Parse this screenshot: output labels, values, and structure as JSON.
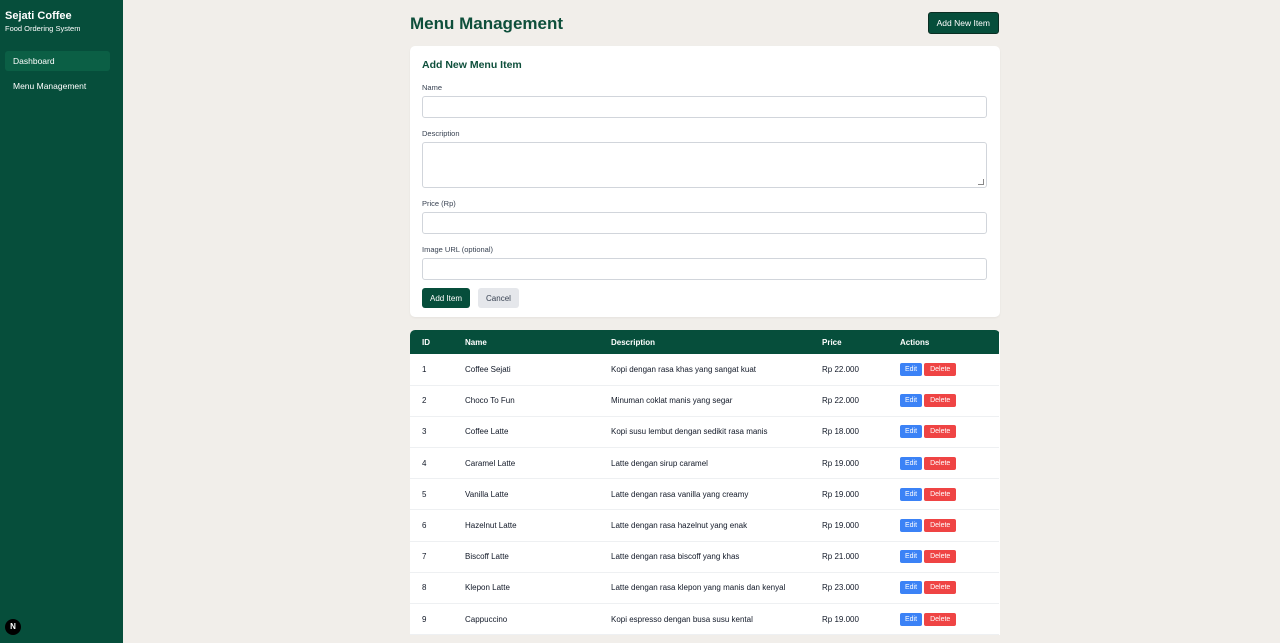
{
  "sidebar": {
    "brand_title": "Sejati Coffee",
    "brand_subtitle": "Food Ordering System",
    "items": [
      {
        "label": "Dashboard",
        "active": true
      },
      {
        "label": "Menu Management",
        "active": false
      }
    ],
    "badge": "N"
  },
  "header": {
    "title": "Menu Management",
    "add_new_label": "Add New Item"
  },
  "form": {
    "title": "Add New Menu Item",
    "name_label": "Name",
    "name_value": "",
    "description_label": "Description",
    "description_value": "",
    "price_label": "Price (Rp)",
    "price_value": "",
    "image_label": "Image URL (optional)",
    "image_value": "",
    "submit_label": "Add Item",
    "cancel_label": "Cancel"
  },
  "table": {
    "columns": [
      "ID",
      "Name",
      "Description",
      "Price",
      "Actions"
    ],
    "edit_label": "Edit",
    "delete_label": "Delete",
    "rows": [
      {
        "id": "1",
        "name": "Coffee Sejati",
        "description": "Kopi dengan rasa khas yang sangat kuat",
        "price": "Rp 22.000"
      },
      {
        "id": "2",
        "name": "Choco To Fun",
        "description": "Minuman coklat manis yang segar",
        "price": "Rp 22.000"
      },
      {
        "id": "3",
        "name": "Coffee Latte",
        "description": "Kopi susu lembut dengan sedikit rasa manis",
        "price": "Rp 18.000"
      },
      {
        "id": "4",
        "name": "Caramel Latte",
        "description": "Latte dengan sirup caramel",
        "price": "Rp 19.000"
      },
      {
        "id": "5",
        "name": "Vanilla Latte",
        "description": "Latte dengan rasa vanilla yang creamy",
        "price": "Rp 19.000"
      },
      {
        "id": "6",
        "name": "Hazelnut Latte",
        "description": "Latte dengan rasa hazelnut yang enak",
        "price": "Rp 19.000"
      },
      {
        "id": "7",
        "name": "Biscoff Latte",
        "description": "Latte dengan rasa biscoff yang khas",
        "price": "Rp 21.000"
      },
      {
        "id": "8",
        "name": "Klepon Latte",
        "description": "Latte dengan rasa klepon yang manis dan kenyal",
        "price": "Rp 23.000"
      },
      {
        "id": "9",
        "name": "Cappuccino",
        "description": "Kopi espresso dengan busa susu kental",
        "price": "Rp 19.000"
      }
    ]
  },
  "colors": {
    "sidebar": "#064e3b",
    "primary": "#064e3b",
    "edit": "#3b82f6",
    "delete": "#ef4444",
    "background": "#f1eeea"
  }
}
